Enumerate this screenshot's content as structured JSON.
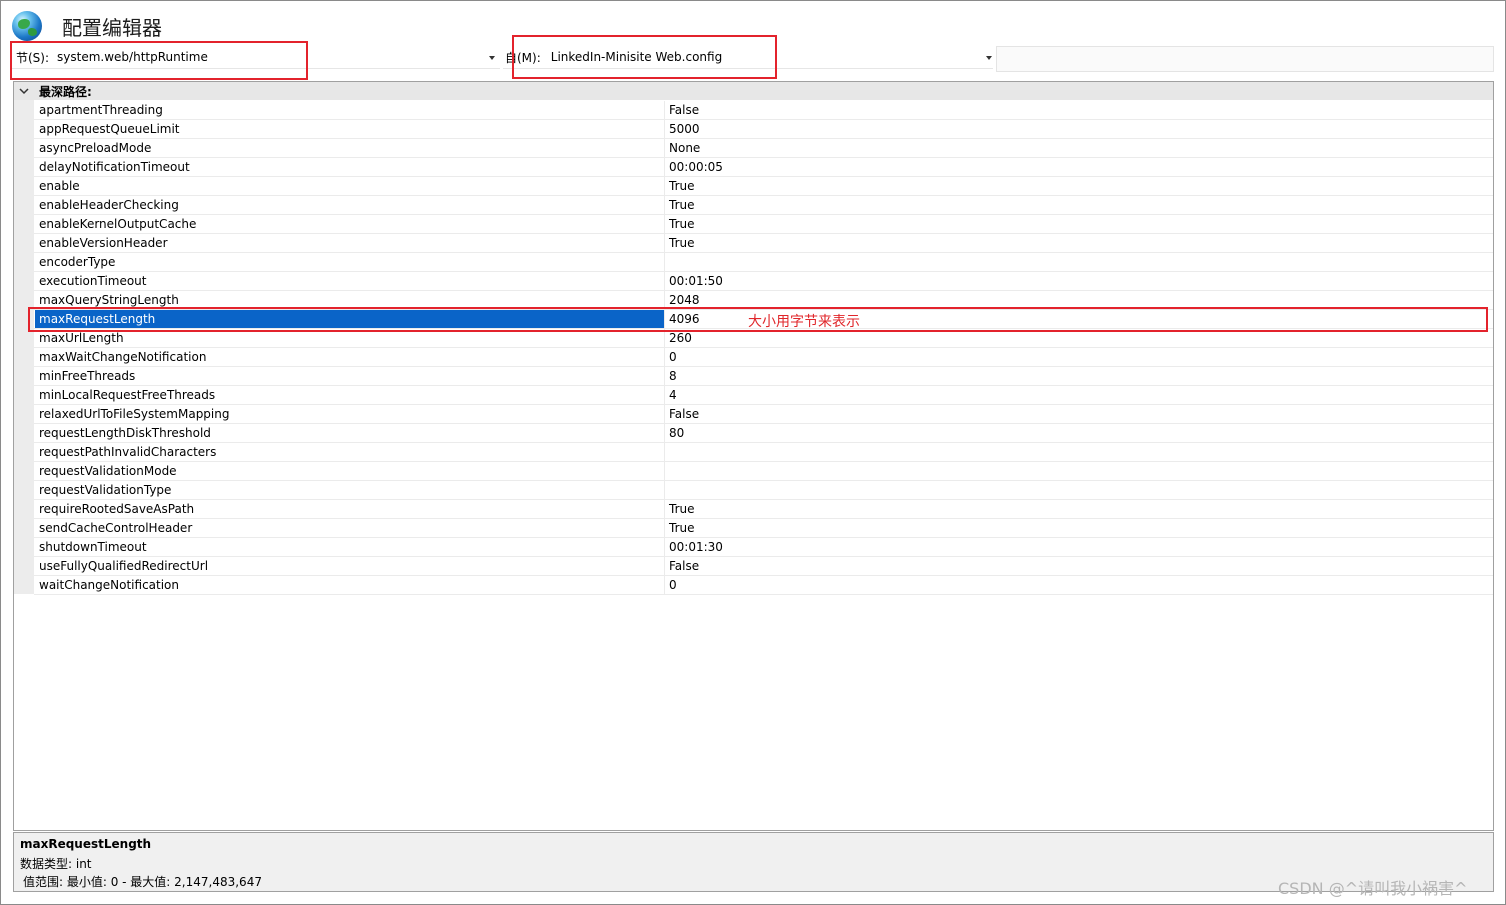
{
  "header": {
    "title": "配置编辑器",
    "icon": "globe-icon"
  },
  "section": {
    "label": "节(S):",
    "value": "system.web/httpRuntime"
  },
  "from": {
    "label": "自(M):",
    "value": "LinkedIn-Minisite Web.config"
  },
  "grid": {
    "group_label": "最深路径:",
    "rows": [
      {
        "name": "apartmentThreading",
        "value": "False"
      },
      {
        "name": "appRequestQueueLimit",
        "value": "5000"
      },
      {
        "name": "asyncPreloadMode",
        "value": "None"
      },
      {
        "name": "delayNotificationTimeout",
        "value": "00:00:05"
      },
      {
        "name": "enable",
        "value": "True"
      },
      {
        "name": "enableHeaderChecking",
        "value": "True"
      },
      {
        "name": "enableKernelOutputCache",
        "value": "True"
      },
      {
        "name": "enableVersionHeader",
        "value": "True"
      },
      {
        "name": "encoderType",
        "value": ""
      },
      {
        "name": "executionTimeout",
        "value": "00:01:50"
      },
      {
        "name": "maxQueryStringLength",
        "value": "2048"
      },
      {
        "name": "maxRequestLength",
        "value": "4096",
        "selected": true,
        "annotation": "大小用字节来表示"
      },
      {
        "name": "maxUrlLength",
        "value": "260"
      },
      {
        "name": "maxWaitChangeNotification",
        "value": "0"
      },
      {
        "name": "minFreeThreads",
        "value": "8"
      },
      {
        "name": "minLocalRequestFreeThreads",
        "value": "4"
      },
      {
        "name": "relaxedUrlToFileSystemMapping",
        "value": "False"
      },
      {
        "name": "requestLengthDiskThreshold",
        "value": "80"
      },
      {
        "name": "requestPathInvalidCharacters",
        "value": ""
      },
      {
        "name": "requestValidationMode",
        "value": ""
      },
      {
        "name": "requestValidationType",
        "value": ""
      },
      {
        "name": "requireRootedSaveAsPath",
        "value": "True"
      },
      {
        "name": "sendCacheControlHeader",
        "value": "True"
      },
      {
        "name": "shutdownTimeout",
        "value": "00:01:30"
      },
      {
        "name": "useFullyQualifiedRedirectUrl",
        "value": "False"
      },
      {
        "name": "waitChangeNotification",
        "value": "0"
      }
    ]
  },
  "description": {
    "title": "maxRequestLength",
    "data_type": "数据类型: int",
    "range": "值范围: 最小值: 0 - 最大值: 2,147,483,647"
  },
  "watermark": "CSDN @^请叫我小祸害^",
  "colors": {
    "selection": "#0a64c8",
    "annotation": "#e0262a"
  }
}
